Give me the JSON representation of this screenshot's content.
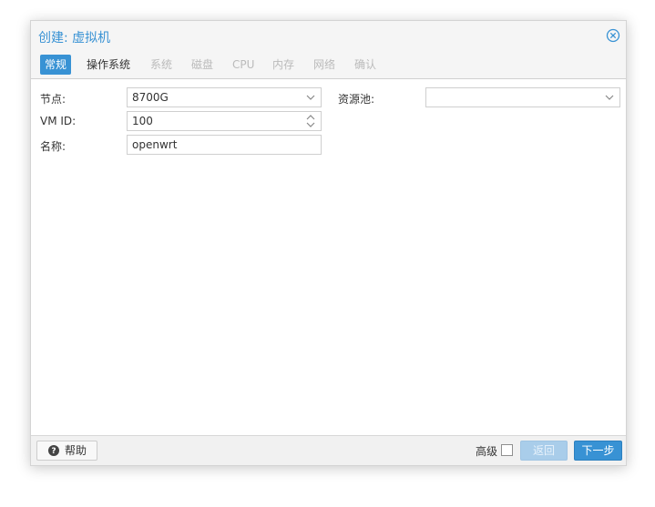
{
  "dialog": {
    "title": "创建: 虚拟机"
  },
  "tabs": [
    {
      "label": "常规",
      "state": "active"
    },
    {
      "label": "操作系统",
      "state": "enabled"
    },
    {
      "label": "系统",
      "state": "disabled"
    },
    {
      "label": "磁盘",
      "state": "disabled"
    },
    {
      "label": "CPU",
      "state": "disabled"
    },
    {
      "label": "内存",
      "state": "disabled"
    },
    {
      "label": "网络",
      "state": "disabled"
    },
    {
      "label": "确认",
      "state": "disabled"
    }
  ],
  "form": {
    "node": {
      "label": "节点:",
      "value": "8700G"
    },
    "vmid": {
      "label": "VM ID:",
      "value": "100"
    },
    "name": {
      "label": "名称:",
      "value": "openwrt"
    },
    "pool": {
      "label": "资源池:",
      "value": ""
    }
  },
  "footer": {
    "help_label": "帮助",
    "advanced_label": "高级",
    "advanced_checked": false,
    "back_label": "返回",
    "next_label": "下一步"
  },
  "colors": {
    "accent": "#3892d4",
    "disabled_button": "#a9cdea"
  }
}
